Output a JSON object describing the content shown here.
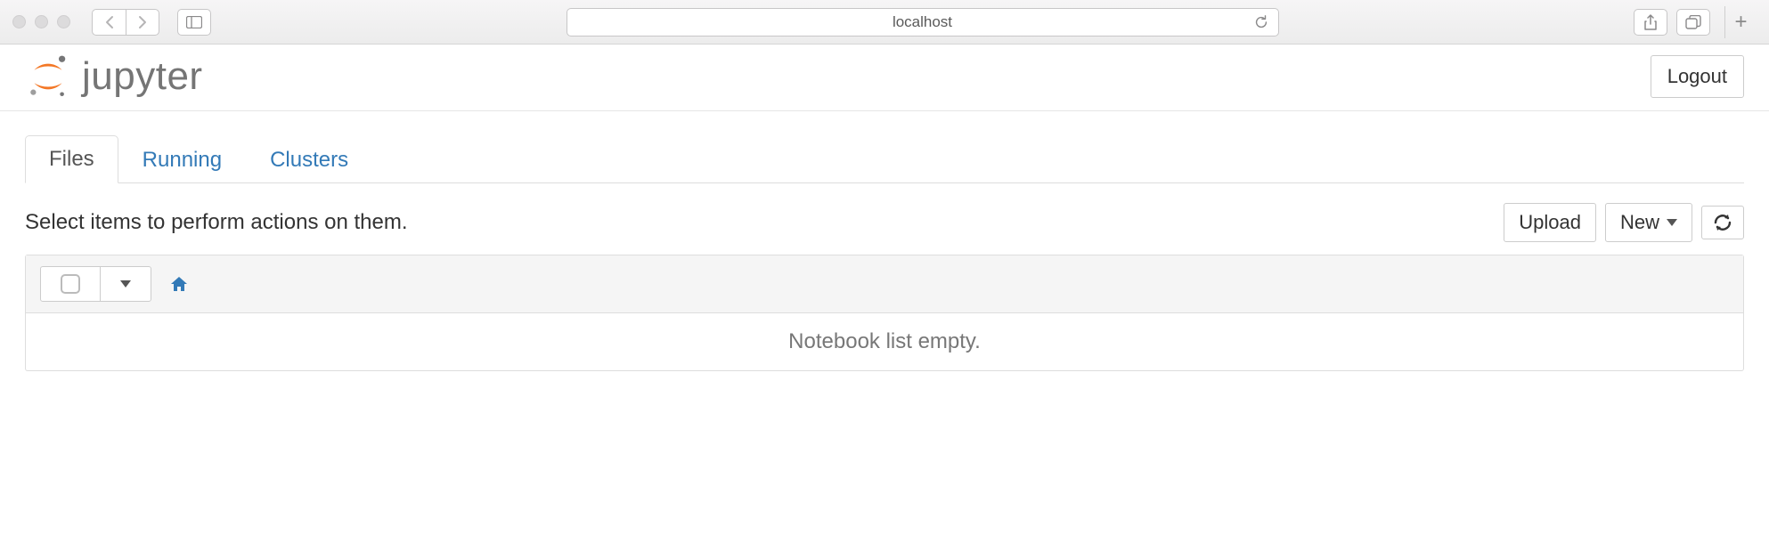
{
  "browser": {
    "address": "localhost"
  },
  "header": {
    "logo_text": "jupyter",
    "logout_label": "Logout"
  },
  "tabs": [
    {
      "label": "Files",
      "active": true
    },
    {
      "label": "Running",
      "active": false
    },
    {
      "label": "Clusters",
      "active": false
    }
  ],
  "toolbar": {
    "hint": "Select items to perform actions on them.",
    "upload_label": "Upload",
    "new_label": "New"
  },
  "list": {
    "empty_message": "Notebook list empty."
  }
}
